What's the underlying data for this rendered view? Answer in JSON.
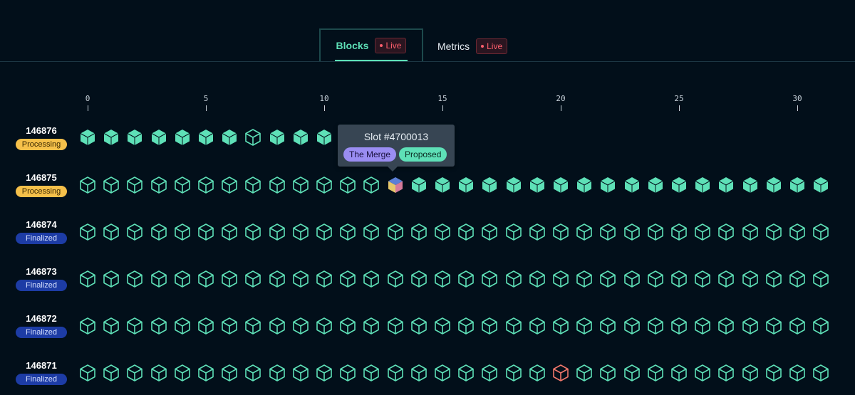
{
  "tabs": [
    {
      "label": "Blocks",
      "badge": "Live",
      "active": true
    },
    {
      "label": "Metrics",
      "badge": "Live",
      "active": false
    }
  ],
  "axis_ticks": [
    "0",
    "5",
    "10",
    "15",
    "20",
    "25",
    "30"
  ],
  "slots_per_epoch": 32,
  "colors": {
    "accent": "#5ee0b7",
    "missed": "#f0776b",
    "processing": "#f5c04a",
    "finalized": "#1d3ca5",
    "live": "#ff5f6d",
    "fork_tag": "#9a8df2"
  },
  "legend_icons": {
    "proposed_block": "filled-cube-icon",
    "empty_slot": "outline-cube-icon",
    "missed_slot": "red-outline-cube-icon",
    "highlighted_slot": "multicolor-cube-icon"
  },
  "epochs": [
    {
      "number": "146876",
      "status": "Processing",
      "slots": "PPPPPPPOPPP"
    },
    {
      "number": "146875",
      "status": "Processing",
      "slots": "OOOOOOOOOOOOOHPPPPPPPPPPPPPPPPPP"
    },
    {
      "number": "146874",
      "status": "Finalized",
      "slots": "OOOOOOOOOOOOOOOOOOOOOOOOOOOOOOOO"
    },
    {
      "number": "146873",
      "status": "Finalized",
      "slots": "OOOOOOOOOOOOOOOOOOOOOOOOOOOOOOOO"
    },
    {
      "number": "146872",
      "status": "Finalized",
      "slots": "OOOOOOOOOOOOOOOOOOOOOOOOOOOOOOOO"
    },
    {
      "number": "146871",
      "status": "Finalized",
      "slots": "OOOOOOOOOOOOOOOOOOOOMOOOOOOOOOOO"
    }
  ],
  "tooltip": {
    "title": "Slot #4700013",
    "fork": "The Merge",
    "status": "Proposed"
  }
}
